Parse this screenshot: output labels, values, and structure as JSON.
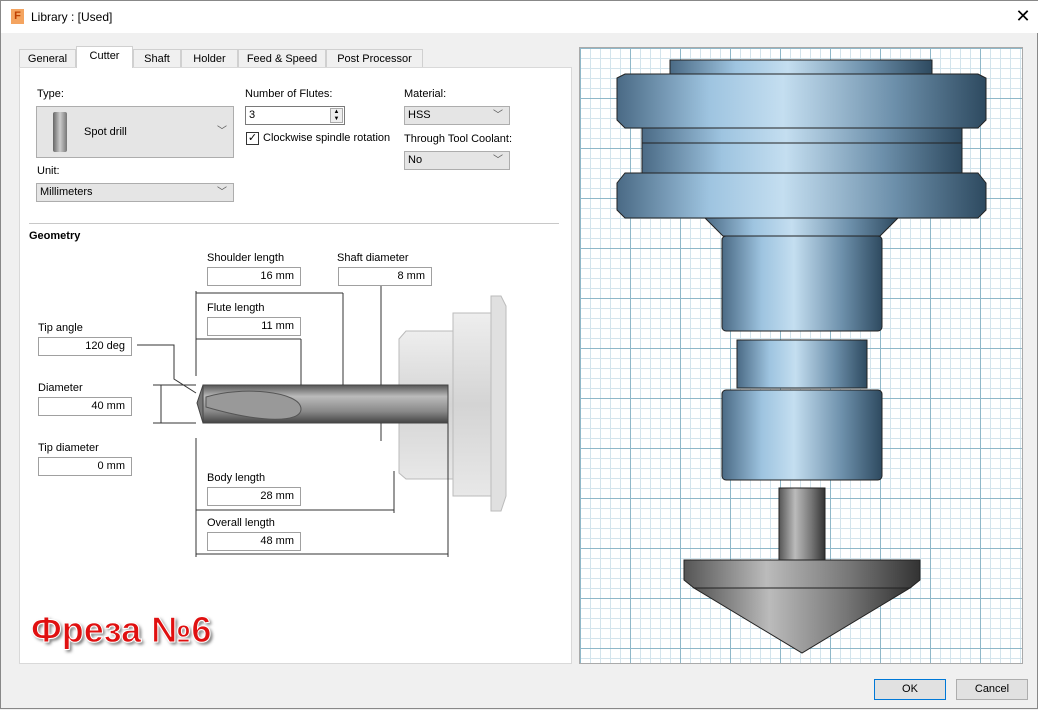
{
  "window": {
    "title": "Library : [Used]",
    "close_icon": "close-icon"
  },
  "tabs": [
    "General",
    "Cutter",
    "Shaft",
    "Holder",
    "Feed & Speed",
    "Post Processor"
  ],
  "active_tab": "Cutter",
  "cutter": {
    "type_label": "Type:",
    "type_value": "Spot drill",
    "unit_label": "Unit:",
    "unit_value": "Millimeters",
    "flutes_label": "Number of Flutes:",
    "flutes_value": "3",
    "clockwise_label": "Clockwise spindle rotation",
    "clockwise_checked": true,
    "material_label": "Material:",
    "material_value": "HSS",
    "coolant_label": "Through Tool Coolant:",
    "coolant_value": "No"
  },
  "geometry": {
    "heading": "Geometry",
    "shoulder_length": {
      "label": "Shoulder length",
      "value": "16 mm"
    },
    "shaft_diameter": {
      "label": "Shaft diameter",
      "value": "8 mm"
    },
    "flute_length": {
      "label": "Flute length",
      "value": "11 mm"
    },
    "tip_angle": {
      "label": "Tip angle",
      "value": "120 deg"
    },
    "diameter": {
      "label": "Diameter",
      "value": "40 mm"
    },
    "tip_diameter": {
      "label": "Tip diameter",
      "value": "0 mm"
    },
    "body_length": {
      "label": "Body length",
      "value": "28 mm"
    },
    "overall_length": {
      "label": "Overall length",
      "value": "48 mm"
    }
  },
  "overlay_text": "Фреза №6",
  "buttons": {
    "ok": "OK",
    "cancel": "Cancel"
  }
}
